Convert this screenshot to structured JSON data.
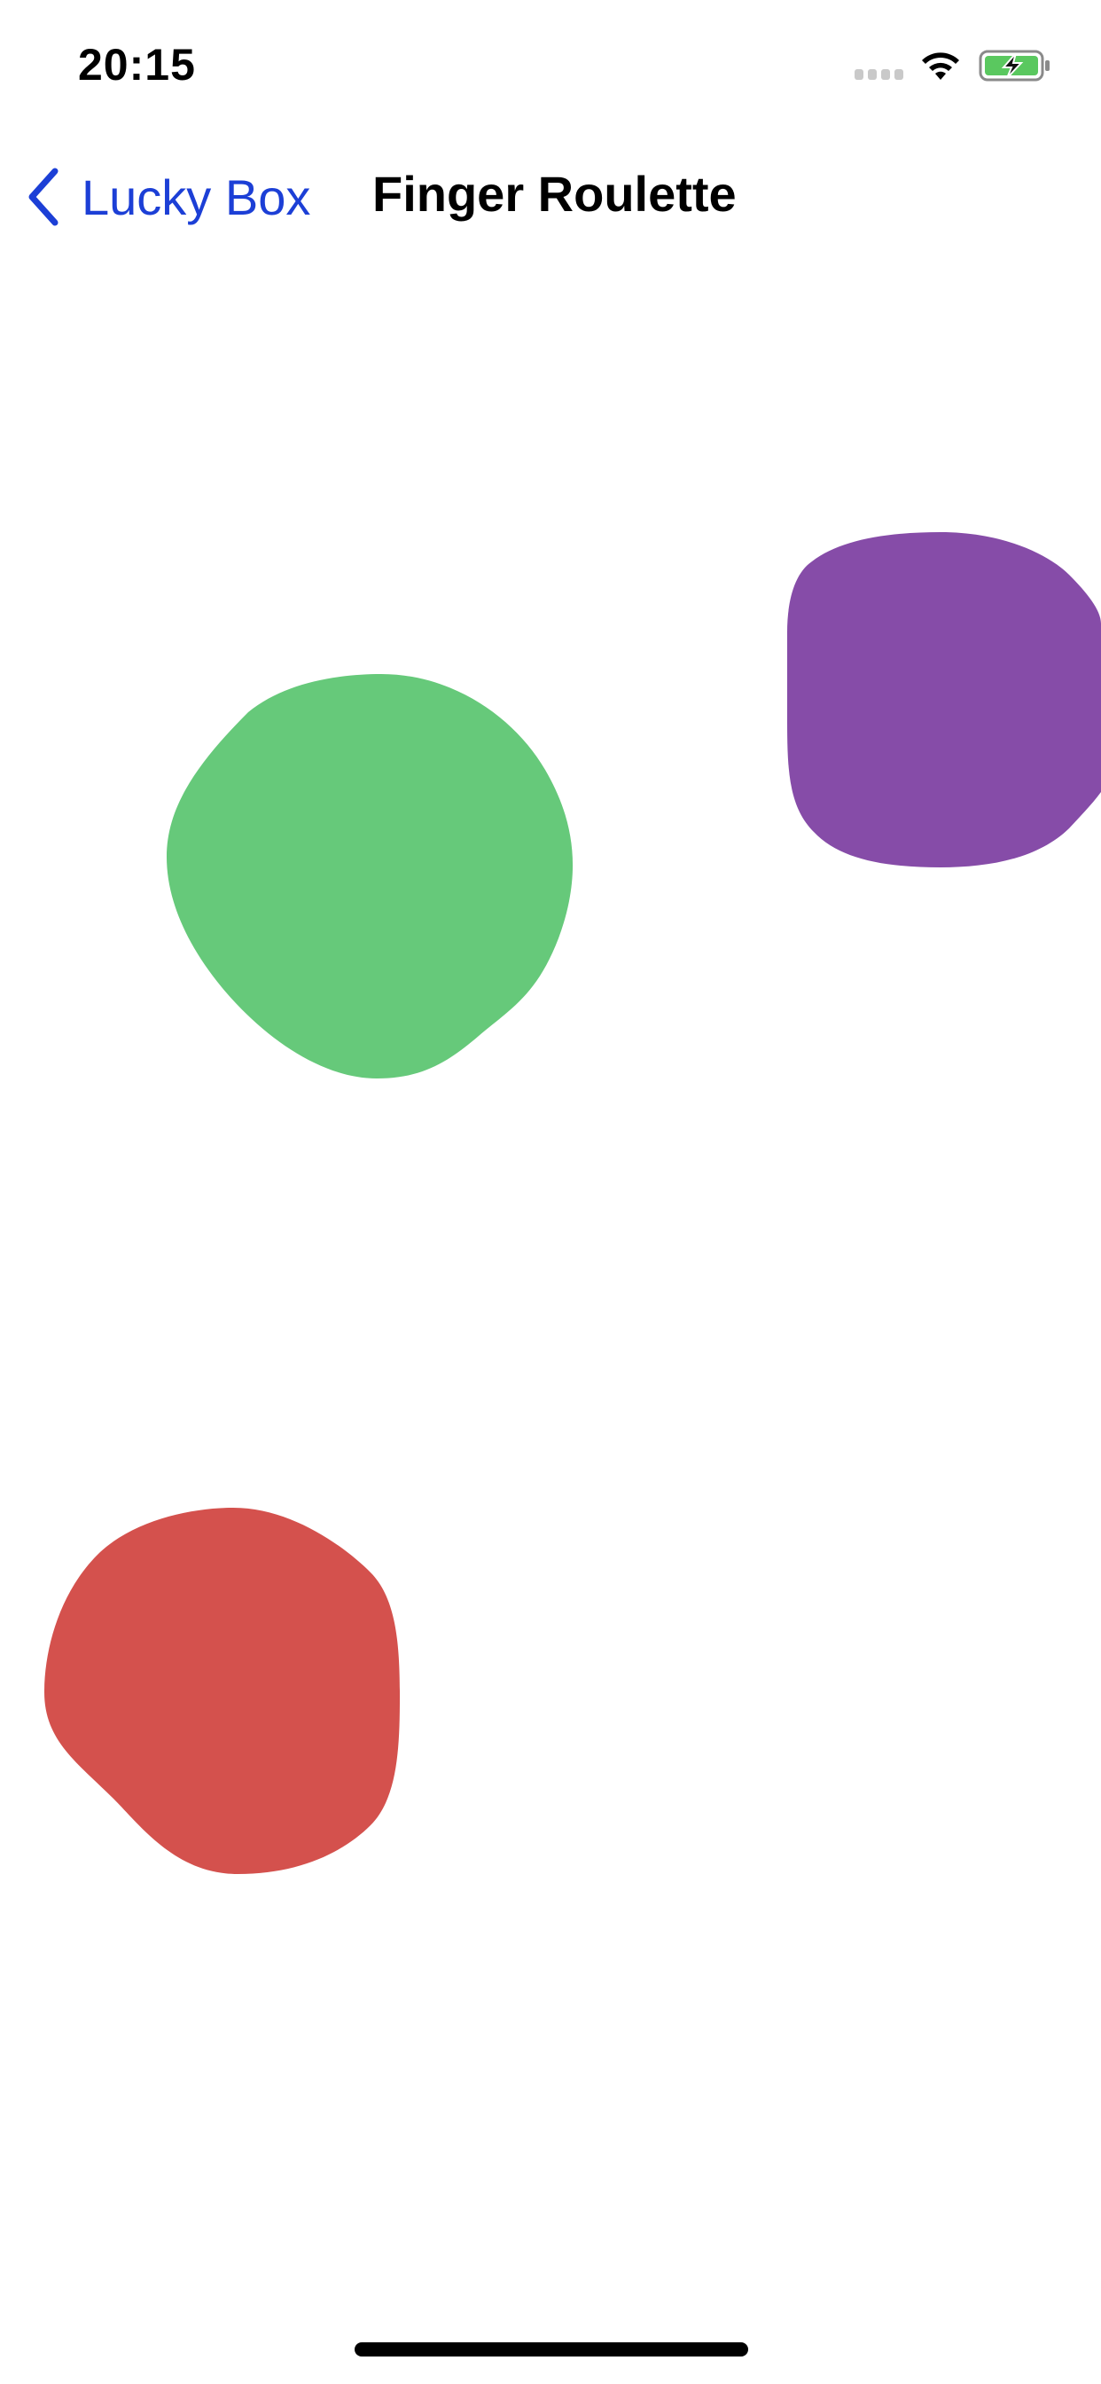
{
  "status_bar": {
    "time": "20:15",
    "icons": [
      "signal-icon",
      "wifi-icon",
      "battery-charging-icon"
    ]
  },
  "nav": {
    "back_label": "Lucky Box",
    "title": "Finger Roulette"
  },
  "touch_points": [
    {
      "name": "green-touch-blob",
      "color": "#66c97a"
    },
    {
      "name": "purple-touch-blob",
      "color": "#864ca8"
    },
    {
      "name": "red-touch-blob",
      "color": "#d4514d"
    }
  ],
  "colors": {
    "accent": "#1c3fd6",
    "battery_fill": "#5ac85f"
  }
}
